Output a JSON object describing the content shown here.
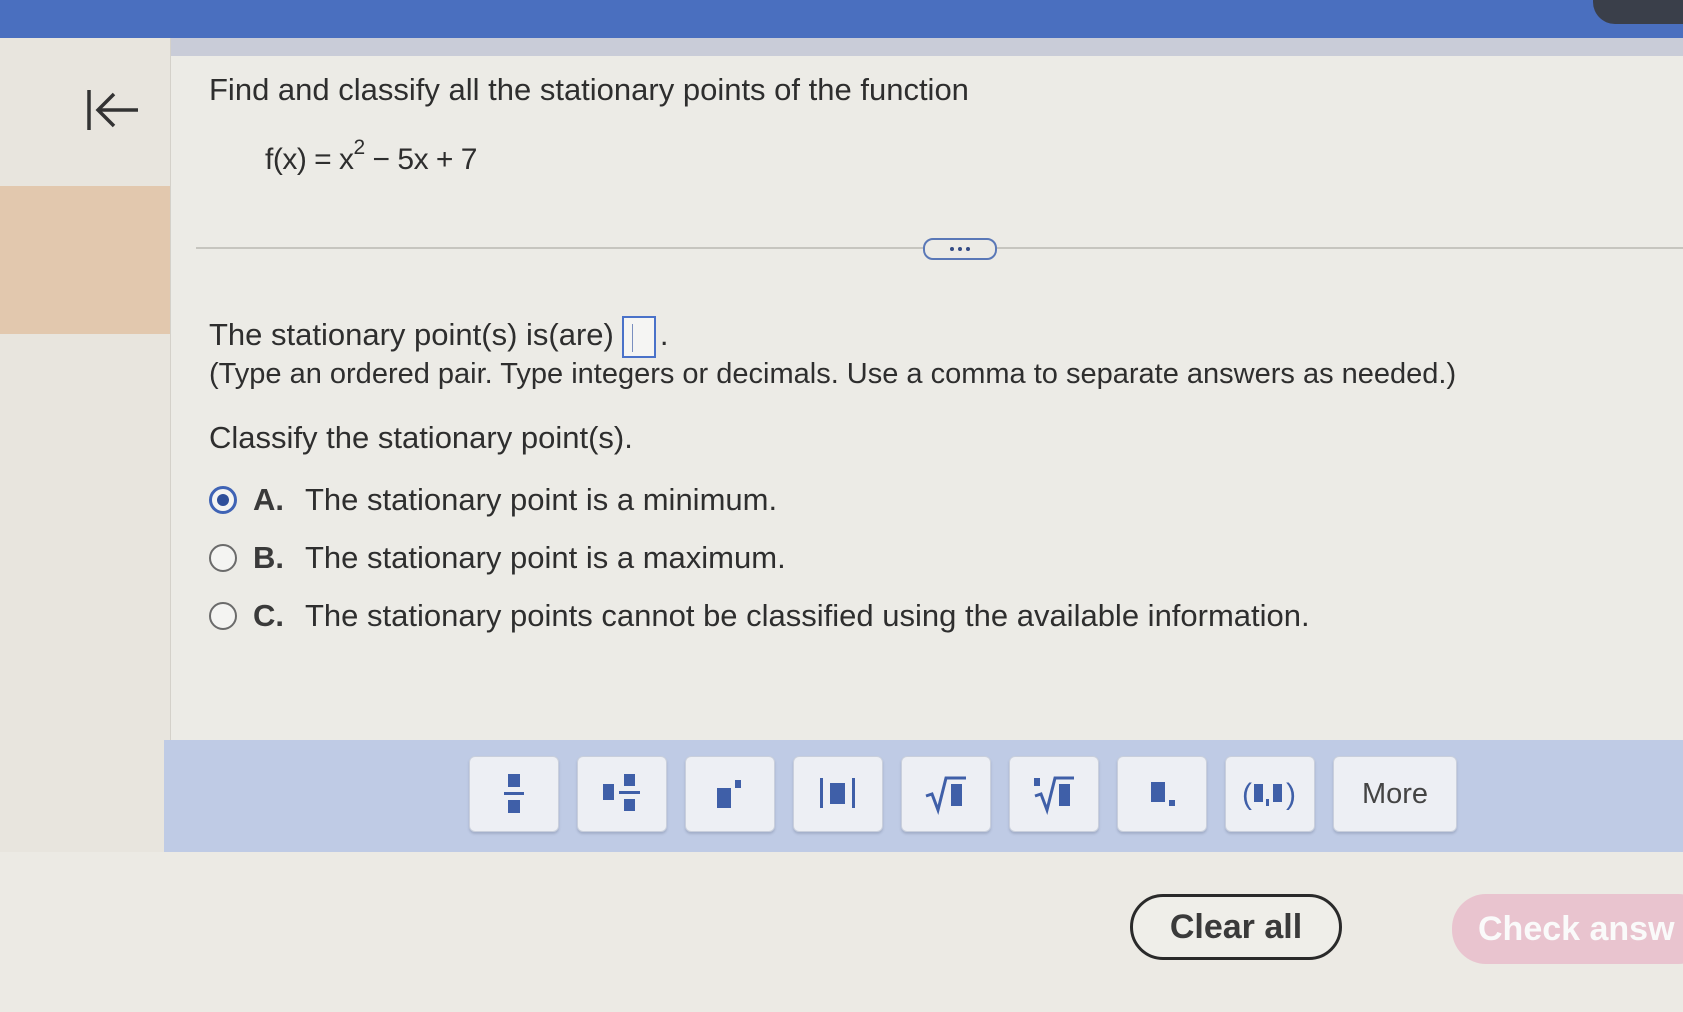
{
  "question": {
    "prompt": "Find and classify all the stationary points of the function",
    "formula": {
      "lhs": "f(x) = x",
      "exponent": "2",
      "rhs": " − 5x + 7"
    }
  },
  "answer": {
    "label": "The stationary point(s) is(are)",
    "value": "",
    "period": ".",
    "hint": "(Type an ordered pair. Type integers or decimals. Use a comma to separate answers as needed.)"
  },
  "classify": {
    "prompt": "Classify the stationary point(s).",
    "options": [
      {
        "letter": "A.",
        "text": "The stationary point is a minimum.",
        "selected": true
      },
      {
        "letter": "B.",
        "text": "The stationary point is a maximum.",
        "selected": false
      },
      {
        "letter": "C.",
        "text": "The stationary points cannot be classified using the available information.",
        "selected": false
      }
    ]
  },
  "toolbar": {
    "buttons": [
      "fraction-icon",
      "mixed-number-icon",
      "superscript-icon",
      "absolute-value-icon",
      "square-root-icon",
      "nth-root-icon",
      "decimal-icon",
      "ordered-pair-icon"
    ],
    "more_label": "More"
  },
  "actions": {
    "clear_label": "Clear all",
    "check_label": "Check answ"
  },
  "colors": {
    "header": "#4a6fbf",
    "accent": "#3f63b5",
    "toolbar": "#bfcbe5",
    "check_button": "#e9c4cf"
  }
}
